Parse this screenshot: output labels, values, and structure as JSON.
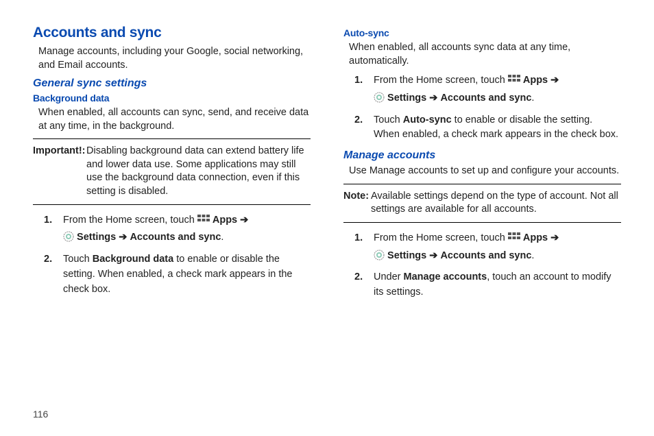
{
  "page_number": "116",
  "left": {
    "h1": "Accounts and sync",
    "intro": "Manage accounts, including your Google, social networking, and Email accounts.",
    "h2_general": "General sync settings",
    "h3_bg": "Background data",
    "bg_desc": "When enabled, all accounts can sync, send, and receive data at any time, in the background.",
    "important_label": "Important!:",
    "important_body": "Disabling background data can extend battery life and lower data use. Some applications may still use the background data connection, even if this setting is disabled.",
    "step1_num": "1.",
    "step1_a": "From the Home screen, touch ",
    "apps_label": " Apps  ",
    "arrow": "➔",
    "settings_label": " Settings ",
    "accounts_sync_label": " Accounts and sync",
    "period": ".",
    "step2_num": "2.",
    "step2_a": "Touch ",
    "step2_bold": "Background data",
    "step2_b": " to enable or disable the setting. When enabled, a check mark appears in the check box."
  },
  "right": {
    "h3_auto": "Auto-sync",
    "auto_desc": "When enabled, all accounts sync data at any time, automatically.",
    "step1_num": "1.",
    "step1_a": "From the Home screen, touch ",
    "step2_num": "2.",
    "step2_a": "Touch ",
    "step2_bold": "Auto-sync",
    "step2_b": " to enable or disable the setting. When enabled, a check mark appears in the check box.",
    "h2_manage": "Manage accounts",
    "manage_desc": "Use Manage accounts to set up and configure your accounts.",
    "note_label": "Note:",
    "note_body": "Available settings depend on the type of account. Not all settings are available for all accounts.",
    "m_step1_num": "1.",
    "m_step2_num": "2.",
    "m_step2_a": "Under ",
    "m_step2_bold": "Manage accounts",
    "m_step2_b": ", touch an account to modify its settings."
  }
}
